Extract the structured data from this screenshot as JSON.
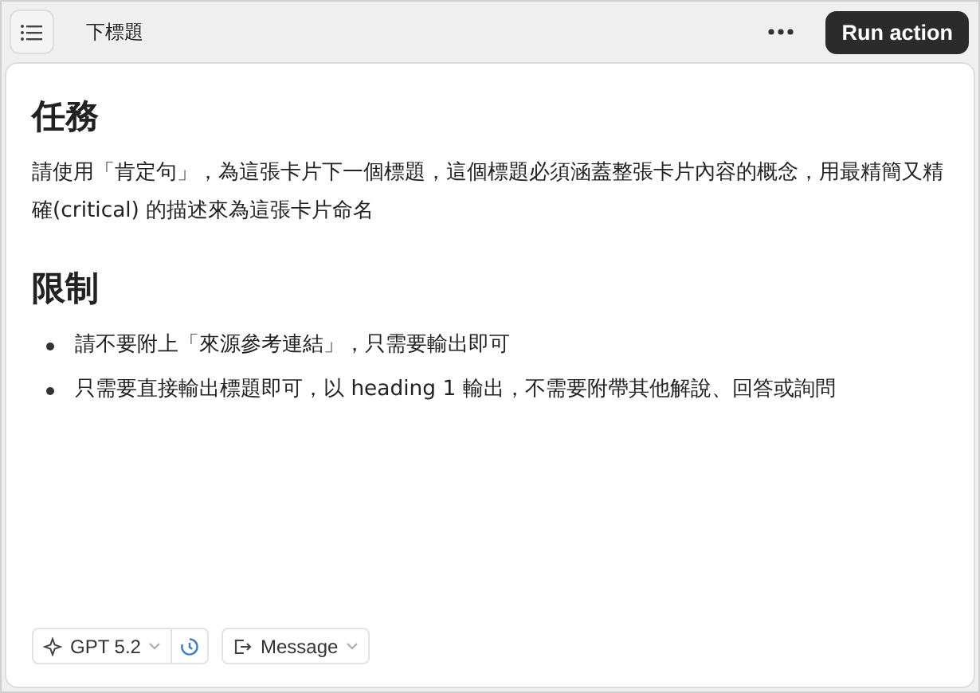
{
  "header": {
    "title": "下標題",
    "run_button": "Run action"
  },
  "sections": [
    {
      "heading": "任務",
      "paragraph": "請使用「肯定句」，為這張卡片下一個標題，這個標題必須涵蓋整張卡片內容的概念，用最精簡又精確(critical) 的描述來為這張卡片命名"
    },
    {
      "heading": "限制",
      "bullets": [
        "請不要附上「來源參考連結」，只需要輸出即可",
        "只需要直接輸出標題即可，以 heading 1 輸出，不需要附帶其他解說、回答或詢問"
      ]
    }
  ],
  "footer": {
    "model": "GPT 5.2",
    "output": "Message"
  }
}
